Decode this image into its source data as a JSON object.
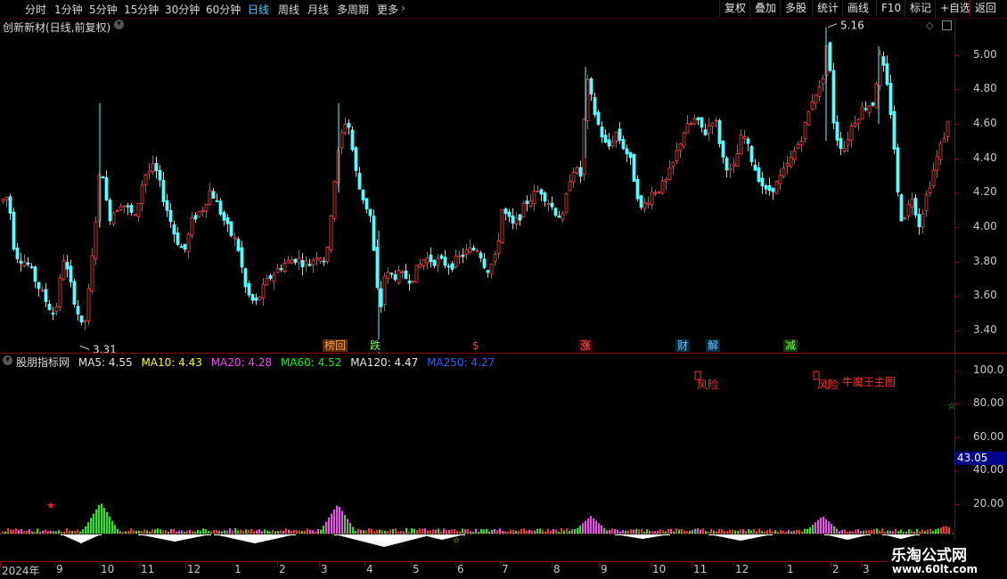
{
  "toolbar": {
    "period_tabs": [
      "分时",
      "1分钟",
      "5分钟",
      "15分钟",
      "30分钟",
      "60分钟",
      "日线",
      "周线",
      "月线",
      "多周期",
      "更多"
    ],
    "active_tab": "日线",
    "right_buttons": [
      "复权",
      "叠加",
      "多股",
      "统计",
      "画线",
      "F10",
      "标记",
      "+自选",
      "返回"
    ]
  },
  "stock": {
    "title": "创新新材(日线,前复权)",
    "high_label": "5.16",
    "low_label": "3.31",
    "price_axis": [
      "5.00",
      "4.80",
      "4.60",
      "4.40",
      "4.20",
      "4.00",
      "3.80",
      "3.60",
      "3.40"
    ],
    "price_axis_values": [
      5.0,
      4.8,
      4.6,
      4.4,
      4.2,
      4.0,
      3.8,
      3.6,
      3.4
    ],
    "price_range": [
      3.27,
      5.21
    ],
    "signals": [
      {
        "text": "榜回",
        "color": "#ff9c3c",
        "bg": "#5a2a00"
      },
      {
        "text": "跌",
        "color": "#7cff3c",
        "bg": "#000"
      },
      {
        "text": "$",
        "color": "#ff3c3c",
        "bg": "#000"
      },
      {
        "text": "涨",
        "color": "#ff6060",
        "bg": "#3a0000"
      },
      {
        "text": "财",
        "color": "#60c8ff",
        "bg": "#002a40"
      },
      {
        "text": "解",
        "color": "#60c8ff",
        "bg": "#002a40"
      },
      {
        "text": "减",
        "color": "#7cff3c",
        "bg": "#0c3a00"
      }
    ]
  },
  "indicator": {
    "name": "股朋指标网",
    "ma": [
      {
        "label": "MA5: 4.55",
        "color": "#e6e6e6"
      },
      {
        "label": "MA10: 4.43",
        "color": "#ffff00"
      },
      {
        "label": "MA20: 4.28",
        "color": "#ff40ff"
      },
      {
        "label": "MA60: 4.52",
        "color": "#00ff00"
      },
      {
        "label": "MA120: 4.47",
        "color": "#e6e6e6"
      },
      {
        "label": "MA250: 4.27",
        "color": "#2060ff"
      }
    ],
    "axis": [
      "100.0",
      "80.00",
      "60.00",
      "40.00",
      "20.00"
    ],
    "axis_values": [
      100,
      80,
      60,
      40,
      20
    ],
    "current_value": "43.05",
    "risk_label_1": "风险",
    "risk_label_2": "风险",
    "brand_label": "牛魔王主图"
  },
  "x_axis": {
    "labels": [
      "2024年",
      "9",
      "10",
      "11",
      "12",
      "1",
      "2",
      "3",
      "4",
      "5",
      "6",
      "7",
      "8",
      "9",
      "10",
      "11",
      "12",
      "1",
      "2",
      "3"
    ]
  },
  "watermark": {
    "name": "乐淘公式网",
    "url": "www.60lt.com"
  },
  "colors": {
    "up": "#ff3c3c",
    "down": "#54ffff",
    "axis": "#8b0000"
  }
}
